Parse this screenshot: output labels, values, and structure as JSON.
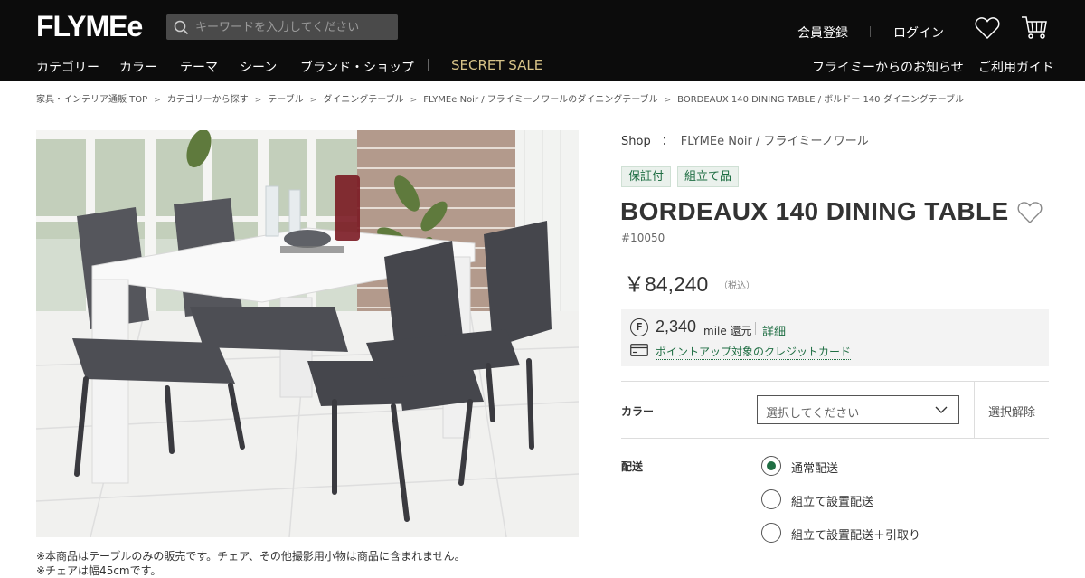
{
  "header": {
    "logo": "FLYMEe",
    "search_placeholder": "キーワードを入力してください",
    "register": "会員登録",
    "login": "ログイン",
    "nav": [
      "カテゴリー",
      "カラー",
      "テーマ",
      "シーン",
      "ブランド・ショップ"
    ],
    "secret_sale": "SECRET SALE",
    "news": "フライミーからのお知らせ",
    "guide": "ご利用ガイド"
  },
  "breadcrumb": [
    "家具・インテリア通販 TOP",
    "カテゴリーから探す",
    "テーブル",
    "ダイニングテーブル",
    "FLYMEe Noir / フライミーノワールのダイニングテーブル",
    "BORDEAUX 140 DINING TABLE / ボルドー 140 ダイニングテーブル"
  ],
  "breadcrumb_separator": ">",
  "product": {
    "notes": [
      "※本商品はテーブルのみの販売です。チェア、その他撮影用小物は商品に含まれません。",
      "※チェアは幅45cmです。"
    ],
    "shop_label": "Shop",
    "shop_colon": "：",
    "shop_name": "FLYMEe Noir / フライミーノワール",
    "tags": [
      "保証付",
      "組立て品"
    ],
    "title": "BORDEAUX 140 DINING TABLE",
    "sku": "#10050",
    "price": "￥84,240",
    "tax": "（税込）",
    "mile_badge": "F",
    "mile_value": "2,340",
    "mile_unit": "mile 還元",
    "mile_detail": "詳細",
    "card_link": "ポイントアップ対象のクレジットカード"
  },
  "options": {
    "color_label": "カラー",
    "color_select": "選択してください",
    "clear": "選択解除",
    "delivery_label": "配送",
    "delivery_options": [
      {
        "label": "通常配送",
        "selected": true
      },
      {
        "label": "組立て設置配送",
        "selected": false
      },
      {
        "label": "組立て設置配送＋引取り",
        "selected": false
      }
    ]
  },
  "colors": {
    "header_bg": "#0c0c0c",
    "accent_green": "#1f6e43",
    "secret_sale_gold": "#d6c287"
  }
}
